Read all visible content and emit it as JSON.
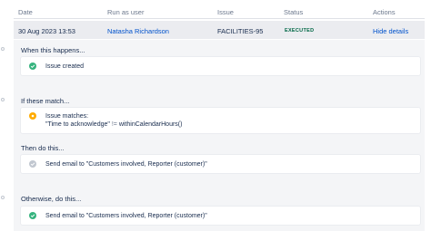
{
  "header": {
    "date": "Date",
    "run_as_user": "Run as user",
    "issue": "Issue",
    "status": "Status",
    "actions": "Actions"
  },
  "row": {
    "date": "30 Aug 2023 13:53",
    "user": "Natasha Richardson",
    "issue": "FACILITIES-95",
    "status": "EXECUTED",
    "action": "Hide details"
  },
  "sections": {
    "trigger_title": "When this happens...",
    "trigger_item": "Issue created",
    "conditions_title": "If these match...",
    "condition_label": "Issue matches:",
    "condition_field": "\"Time to acknowledge\"",
    "condition_op": "!=",
    "condition_value": "withinCalendarHours()",
    "then_title": "Then do this...",
    "then_item": "Send email to \"Customers involved, Reporter (customer)\"",
    "otherwise_title": "Otherwise, do this...",
    "otherwise_item": "Send email to \"Customers involved, Reporter (customer)\""
  },
  "icons": {
    "success": "check-circle-icon",
    "condition": "dot-circle-icon",
    "skipped": "check-circle-icon-muted"
  },
  "colors": {
    "link": "#0052cc",
    "executed": "#006644",
    "success_icon": "#36b37e",
    "condition_icon": "#ffab00",
    "skipped_icon": "#c1c7d0",
    "row_selected": "#ebecf0",
    "panel": "#f4f5f7"
  }
}
